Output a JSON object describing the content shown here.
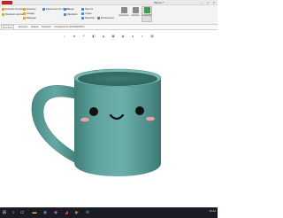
{
  "window": {
    "title": "Pièce1 *",
    "controls": {
      "minimize": "–",
      "maximize": "□",
      "close": "✕"
    }
  },
  "ribbon": {
    "tools": [
      {
        "label": "Extrusion de base",
        "icon": "extrude-boss-icon",
        "color": "#d9a23b"
      },
      {
        "label": "Révolution de base",
        "icon": "revolve-boss-icon",
        "color": "#d9a23b"
      },
      {
        "label": "Extrusion",
        "icon": "extrude-icon",
        "color": "#d9a23b"
      },
      {
        "label": "Lissage",
        "icon": "loft-icon",
        "color": "#d9a23b"
      },
      {
        "label": "Balayage",
        "icon": "sweep-icon",
        "color": "#d9a23b"
      },
      {
        "label": "Enlèvement de matière",
        "icon": "cut-extrude-icon",
        "color": "#4f88c6"
      },
      {
        "label": "Congé",
        "icon": "fillet-icon",
        "color": "#4f88c6"
      },
      {
        "label": "Répétition",
        "icon": "pattern-icon",
        "color": "#4f88c6"
      },
      {
        "label": "Nervure",
        "icon": "rib-icon",
        "color": "#4f88c6"
      },
      {
        "label": "Coque",
        "icon": "shell-icon",
        "color": "#4f88c6"
      },
      {
        "label": "Dépouille",
        "icon": "draft-icon",
        "color": "#4f88c6"
      },
      {
        "label": "Enroulement",
        "icon": "wrap-icon",
        "color": "#4f88c6"
      },
      {
        "label": "Géométrie",
        "icon": "reference-geometry-icon",
        "color": "#8a8a8a"
      },
      {
        "label": "Courbes",
        "icon": "curves-icon",
        "color": "#8a8a8a"
      },
      {
        "label": "Instant3D",
        "icon": "instant3d-icon",
        "color": "#3aa04a"
      }
    ]
  },
  "cmdtabs": [
    "Fonctions",
    "Esquisse",
    "Évaluer",
    "DimXpert",
    "Compléments SOLIDWORKS"
  ],
  "hud": {
    "icons": [
      "zoom-fit-icon",
      "zoom-area-icon",
      "previous-view-icon",
      "section-view-icon",
      "view-orientation-icon",
      "display-style-icon",
      "hide-show-icon",
      "appearance-icon",
      "scene-icon",
      "display-settings-icon"
    ]
  },
  "model": {
    "mug_color": "#5e9e99",
    "face": "cute smiling face"
  },
  "taskbar": {
    "time": "15:42",
    "apps": [
      "windows-start-icon",
      "search-icon",
      "file-explorer-icon",
      "browser-icon",
      "solidworks-icon",
      "visual-studio-icon",
      "media-icon",
      "mail-icon",
      "files-icon"
    ]
  }
}
